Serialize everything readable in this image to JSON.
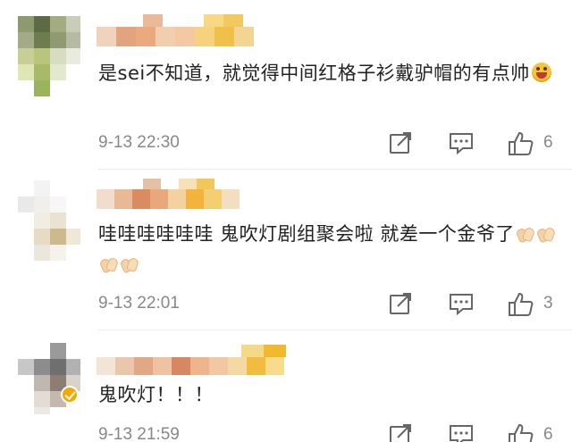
{
  "comments": [
    {
      "text": "是sei不知道，就觉得中间红格子衫戴驴帽的有点帅",
      "emoji": "grinning-face-emoji",
      "time": "9-13 22:30",
      "likes": "6"
    },
    {
      "text": "哇哇哇哇哇哇 鬼吹灯剧组聚会啦  就差一个金爷了",
      "emoji": "clapping-hands-emoji",
      "time": "9-13 22:01",
      "likes": "3"
    },
    {
      "text": "鬼吹灯！！！",
      "time": "9-13 21:59",
      "likes": "6"
    }
  ],
  "icons": {
    "share": "share-icon",
    "reply": "comment-icon",
    "like": "thumbs-up-icon"
  },
  "colors": {
    "text": "#222222",
    "meta": "#888888",
    "icon": "#666666",
    "divider": "#ececec",
    "verified_badge": "#f2a900"
  }
}
